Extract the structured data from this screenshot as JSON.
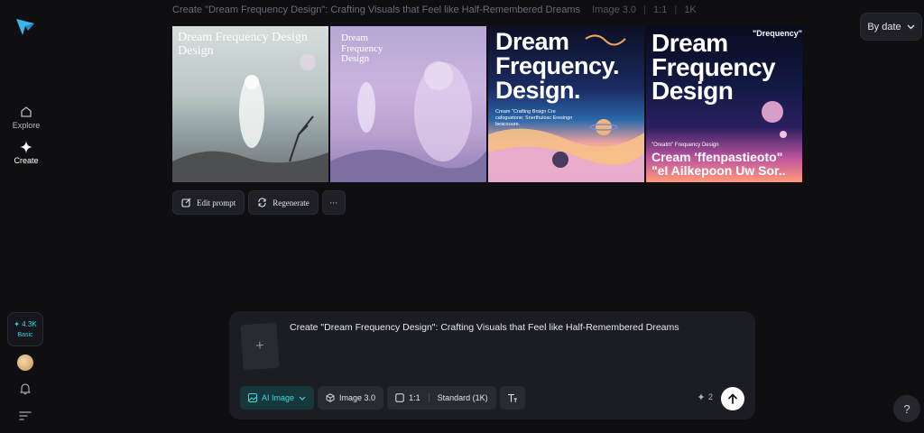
{
  "sidebar": {
    "explore_label": "Explore",
    "create_label": "Create",
    "credits_amount": "✦ 4.3K",
    "credits_tier": "Basic"
  },
  "header": {
    "prompt": "Create \"Dream Frequency Design\": Crafting Visuals that Feel like Half-Remembered Dreams",
    "model": "Image 3.0",
    "ratio": "1:1",
    "resolution": "1K"
  },
  "sort": {
    "label": "By date"
  },
  "gallery": {
    "img1": {
      "caption": "Dream Frequency Design Design"
    },
    "img2": {
      "caption": "Dream Frequency Design"
    },
    "img3": {
      "headline": "Dream Frequency. Design.",
      "small": "Cream \"Crafting Brsign Cre cafogustone; Snerthulosc Eresingn beacsuure."
    },
    "img4": {
      "tag": "\"Drequency\"",
      "headline": "Dream Frequency Design",
      "foot_small": "\"Oreatm\" Frequency Design",
      "foot_big": "Cream 'ffenpastieoto\" \"eI Ailkepoon Uw Sor.."
    }
  },
  "actions": {
    "edit_label": "Edit prompt",
    "regenerate_label": "Regenerate",
    "more_label": "···"
  },
  "composer": {
    "prompt": "Create \"Dream Frequency Design\": Crafting Visuals that Feel like Half-Remembered Dreams",
    "upload_symbol": "+",
    "mode_label": "AI Image",
    "model_label": "Image 3.0",
    "ratio_label": "1:1",
    "quality_label": "Standard (1K)",
    "count": "2"
  },
  "help": {
    "label": "?"
  }
}
